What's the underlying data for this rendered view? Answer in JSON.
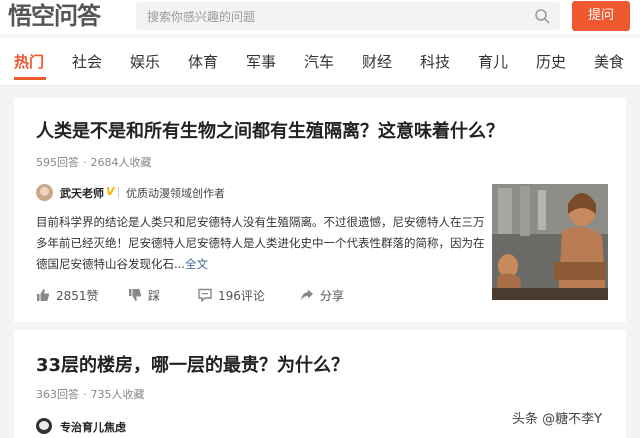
{
  "header": {
    "logo_text": "悟空问答",
    "search_placeholder": "搜索你感兴趣的问题",
    "ask_button": "提问"
  },
  "nav": {
    "items": [
      {
        "label": "热门",
        "active": true
      },
      {
        "label": "社会"
      },
      {
        "label": "娱乐"
      },
      {
        "label": "体育"
      },
      {
        "label": "军事"
      },
      {
        "label": "汽车"
      },
      {
        "label": "财经"
      },
      {
        "label": "科技"
      },
      {
        "label": "育儿"
      },
      {
        "label": "历史"
      },
      {
        "label": "美食"
      }
    ]
  },
  "questions": [
    {
      "title": "人类是不是和所有生物之间都有生殖隔离？这意味着什么？",
      "answers": "595回答",
      "favorites": "2684人收藏",
      "author": {
        "name": "武天老师",
        "verified": "V",
        "description": "优质动漫领域创作者"
      },
      "answer_text": "目前科学界的结论是人类只和尼安德特人没有生殖隔离。不过很遗憾，尼安德特人在三万多年前已经灭绝！尼安德特人尼安德特人是人类进化史中一个代表性群落的简称，因为在德国尼安德特山谷发现化石...",
      "read_more": "全文",
      "likes": "2851赞",
      "dislike": "踩",
      "comments": "196评论",
      "share": "分享"
    },
    {
      "title": "33层的楼房，哪一层的最贵？为什么？",
      "answers": "363回答",
      "favorites": "735人收藏",
      "author": {
        "name": "专治育儿焦虑"
      }
    }
  ],
  "watermark": "头条 @糖不李Y",
  "colors": {
    "accent": "#f0582f",
    "link": "#406599",
    "verified": "#f5b400"
  }
}
